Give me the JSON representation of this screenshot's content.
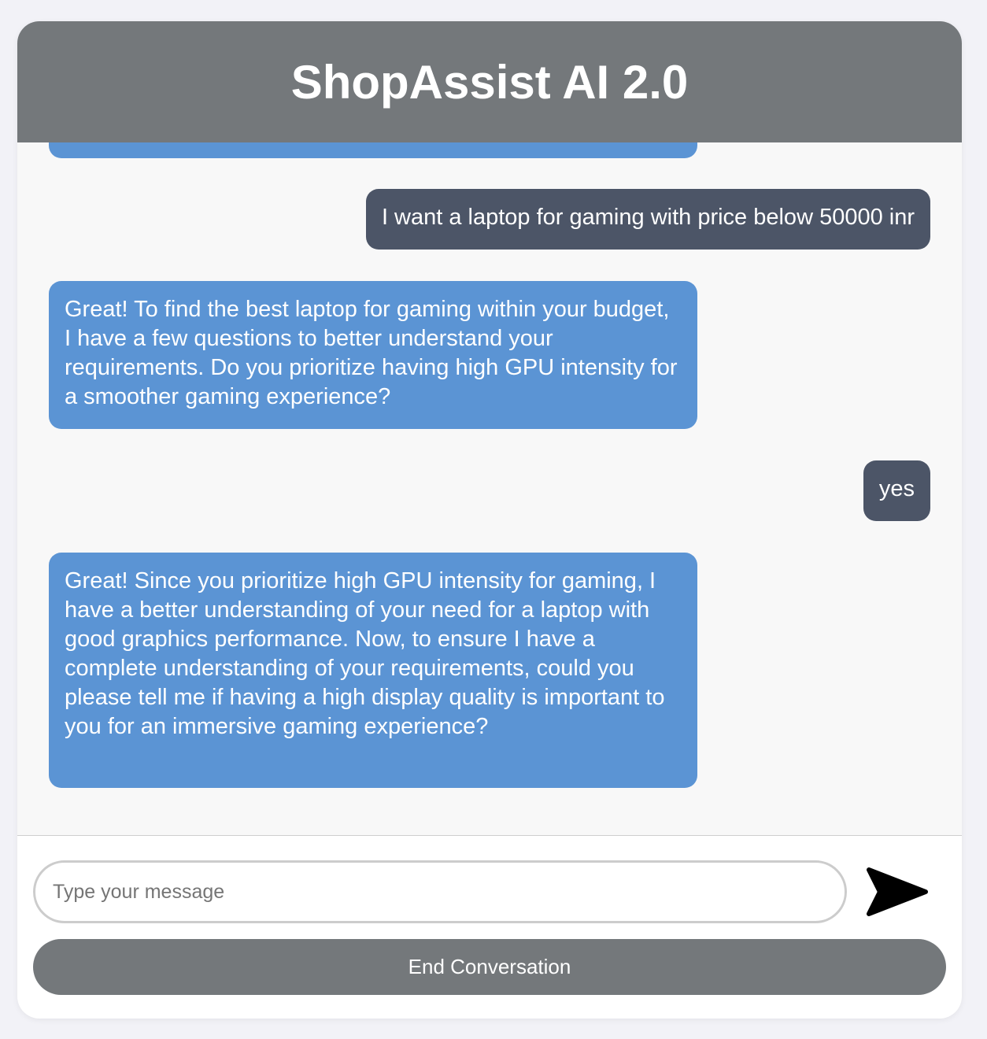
{
  "header": {
    "title": "ShopAssist AI 2.0"
  },
  "messages": [
    {
      "role": "bot",
      "text": ""
    },
    {
      "role": "user",
      "text": "I want a laptop for gaming with price below 50000 inr"
    },
    {
      "role": "bot",
      "text": "Great! To find the best laptop for gaming within your budget, I have a few questions to better understand your requirements. Do you prioritize having high GPU intensity for a smoother gaming experience?"
    },
    {
      "role": "user",
      "text": "yes"
    },
    {
      "role": "bot",
      "text": "Great! Since you prioritize high GPU intensity for gaming, I have a better understanding of your need for a laptop with good graphics performance. Now, to ensure I have a complete understanding of your requirements, could you please tell me if having a high display quality is important to you for an immersive gaming experience?"
    }
  ],
  "composer": {
    "placeholder": "Type your message",
    "value": "",
    "send_icon": "send-arrow-icon"
  },
  "end_button": {
    "label": "End Conversation"
  },
  "colors": {
    "header_bg": "#74787b",
    "bot_bubble": "#5b94d4",
    "user_bubble": "#4c5567",
    "chat_bg": "#f8f8f8"
  }
}
